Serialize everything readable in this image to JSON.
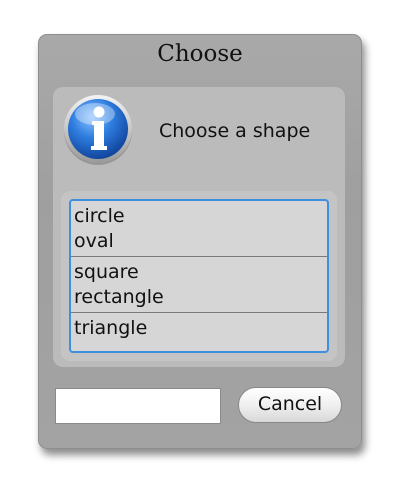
{
  "dialog": {
    "title": "Choose",
    "message": "Choose a shape",
    "icon": "info-icon",
    "list": {
      "groups": [
        [
          "circle",
          "oval"
        ],
        [
          "square",
          "rectangle"
        ],
        [
          "triangle"
        ]
      ]
    },
    "input": {
      "value": "",
      "placeholder": ""
    },
    "cancel_label": "Cancel"
  },
  "colors": {
    "focus_ring": "#3f8fe0",
    "icon_blue": "#1f64c8"
  }
}
